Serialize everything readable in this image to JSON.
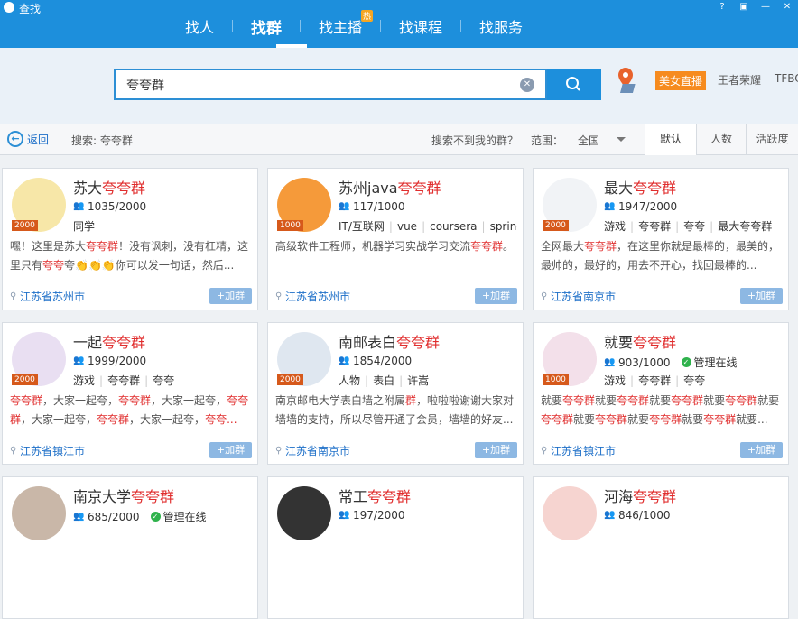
{
  "app": {
    "title": "查找"
  },
  "nav": {
    "tabs": [
      {
        "label": "找人"
      },
      {
        "label": "找群"
      },
      {
        "label": "找主播",
        "badge": "热"
      },
      {
        "label": "找课程"
      },
      {
        "label": "找服务"
      }
    ]
  },
  "search": {
    "value": "夸夸群"
  },
  "hot": {
    "live": "美女直播",
    "kings": "王者荣耀",
    "tfboys": "TFBO"
  },
  "subbar": {
    "back": "返回",
    "search_label": "搜索: 夸夸群",
    "notfound": "搜索不到我的群？",
    "range_label": "范围：",
    "range_value": "全国",
    "sort": [
      "默认",
      "人数",
      "活跃度"
    ]
  },
  "join_label": "+加群",
  "cards": [
    {
      "name": "苏大",
      "hl": "夸夸群",
      "cap": "2000",
      "members": "1035/2000",
      "admin": "",
      "tags": [
        "同学"
      ],
      "desc": [
        [
          "嘿！这里是苏大",
          ""
        ],
        [
          "夸夸群",
          "hl"
        ],
        [
          "！没有讽刺，没有杠精，这里只有",
          ""
        ],
        [
          "夸夸",
          "hl"
        ],
        [
          "夸👏👏👏你可以发一句话，然后...",
          ""
        ]
      ],
      "loc": "江苏省苏州市"
    },
    {
      "name": "苏州java",
      "hl": "夸夸群",
      "cap": "1000",
      "members": "117/1000",
      "admin": "",
      "tags": [
        "IT/互联网",
        "vue",
        "coursera",
        "spring..."
      ],
      "desc": [
        [
          "高级软件工程师，机器学习实战学习交流",
          ""
        ],
        [
          "夸夸群",
          "hl"
        ],
        [
          "。",
          ""
        ]
      ],
      "loc": "江苏省苏州市"
    },
    {
      "name": "最大",
      "hl": "夸夸群",
      "cap": "2000",
      "members": "1947/2000",
      "admin": "",
      "tags": [
        "游戏",
        "夸夸群",
        "夸夸",
        "最大夸夸群"
      ],
      "desc": [
        [
          "全网最大",
          ""
        ],
        [
          "夸夸群",
          "hl"
        ],
        [
          "，在这里你就是最棒的，最美的，最帅的，最好的，用去不开心，找回最棒的...",
          ""
        ]
      ],
      "loc": "江苏省南京市"
    },
    {
      "name": "一起",
      "hl": "夸夸群",
      "cap": "2000",
      "members": "1999/2000",
      "admin": "",
      "tags": [
        "游戏",
        "夸夸群",
        "夸夸"
      ],
      "desc": [
        [
          "夸夸群",
          "hl"
        ],
        [
          "，大家一起夸，",
          ""
        ],
        [
          "夸夸群",
          "hl"
        ],
        [
          "，大家一起夸，",
          ""
        ],
        [
          "夸夸群",
          "hl"
        ],
        [
          "，大家一起夸，",
          ""
        ],
        [
          "夸夸群",
          "hl"
        ],
        [
          "，大家一起夸，",
          ""
        ],
        [
          "夸夸...",
          "hl"
        ]
      ],
      "loc": "江苏省镇江市"
    },
    {
      "name": "南邮表白",
      "hl": "夸夸群",
      "cap": "2000",
      "members": "1854/2000",
      "admin": "",
      "tags": [
        "人物",
        "表白",
        "许嵩"
      ],
      "desc": [
        [
          "南京邮电大学表白墙之附属",
          ""
        ],
        [
          "群",
          "hl"
        ],
        [
          "，啦啦啦谢谢大家对墙墙的支持，所以尽管开通了会员，墙墙的好友...",
          ""
        ]
      ],
      "loc": "江苏省南京市"
    },
    {
      "name": "就要",
      "hl": "夸夸群",
      "cap": "1000",
      "members": "903/1000",
      "admin": "管理在线",
      "tags": [
        "游戏",
        "夸夸群",
        "夸夸"
      ],
      "desc": [
        [
          "就要",
          ""
        ],
        [
          "夸夸群",
          "hl"
        ],
        [
          "就要",
          ""
        ],
        [
          "夸夸群",
          "hl"
        ],
        [
          "就要",
          ""
        ],
        [
          "夸夸群",
          "hl"
        ],
        [
          "就要",
          ""
        ],
        [
          "夸夸群",
          "hl"
        ],
        [
          "就要",
          ""
        ],
        [
          "夸夸群",
          "hl"
        ],
        [
          "就要",
          ""
        ],
        [
          "夸夸群",
          "hl"
        ],
        [
          "就要",
          ""
        ],
        [
          "夸夸群",
          "hl"
        ],
        [
          "就要",
          ""
        ],
        [
          "夸夸群",
          "hl"
        ],
        [
          "就要...",
          ""
        ]
      ],
      "loc": "江苏省镇江市"
    },
    {
      "name": "南京大学",
      "hl": "夸夸群",
      "cap": "",
      "members": "685/2000",
      "admin": "管理在线",
      "tags": [],
      "desc": [],
      "loc": ""
    },
    {
      "name": "常工",
      "hl": "夸夸群",
      "cap": "",
      "members": "197/2000",
      "admin": "",
      "tags": [],
      "desc": [],
      "loc": ""
    },
    {
      "name": "河海",
      "hl": "夸夸群",
      "cap": "",
      "members": "846/1000",
      "admin": "",
      "tags": [],
      "desc": [],
      "loc": ""
    }
  ]
}
